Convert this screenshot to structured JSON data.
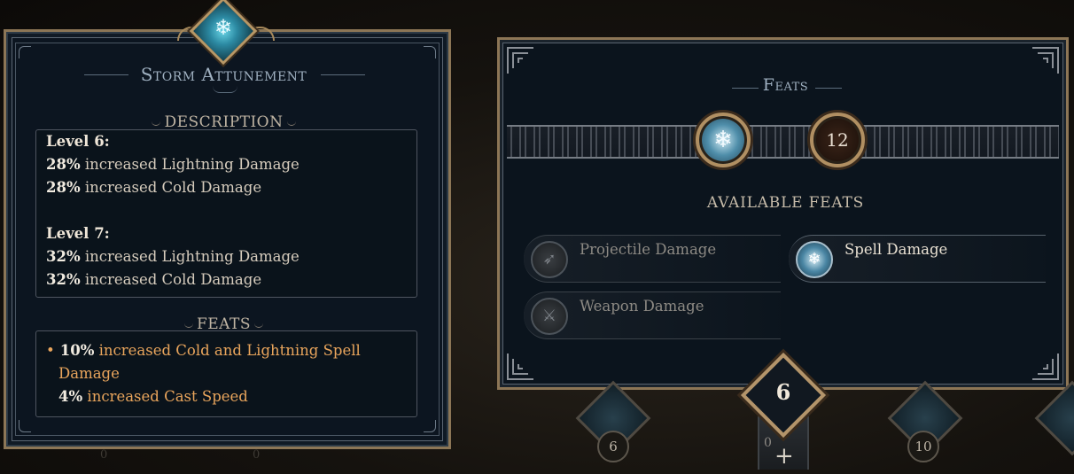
{
  "skill": {
    "title": "Storm Attunement",
    "description_header": "DESCRIPTION",
    "levels": [
      {
        "label": "Level 6:",
        "lines": [
          {
            "value": "28%",
            "text": " increased Lightning Damage"
          },
          {
            "value": "28%",
            "text": " increased Cold Damage"
          }
        ]
      },
      {
        "label": "Level 7:",
        "lines": [
          {
            "value": "32%",
            "text": " increased Lightning Damage"
          },
          {
            "value": "32%",
            "text": " increased Cold Damage"
          }
        ]
      }
    ],
    "feats_header": "FEATS",
    "feat_lines": [
      {
        "bullet": "•",
        "value": "10%",
        "text": " increased Cold and Lightning Spell"
      },
      {
        "bullet": "",
        "value": "",
        "text": "Damage"
      },
      {
        "bullet": "",
        "value": "4%",
        "text": " increased Cast Speed"
      }
    ],
    "under_numbers": [
      "0",
      "0"
    ]
  },
  "feats_panel": {
    "title": "Feats",
    "points": "12",
    "available_label": "AVAILABLE FEATS",
    "options": [
      {
        "label": "Projectile Damage",
        "icon": "arrow-icon",
        "active": false
      },
      {
        "label": "Spell Damage",
        "icon": "storm-spell-icon",
        "active": true
      },
      {
        "label": "Weapon Damage",
        "icon": "sword-icon",
        "active": false
      }
    ]
  },
  "tree_nodes": {
    "left": "6",
    "center": "6",
    "center_sub": "0",
    "center_plus": "+",
    "right": "10"
  },
  "colors": {
    "gold": "#b08f62",
    "highlight": "#e9a55c",
    "frost": "#6bd7e8"
  }
}
